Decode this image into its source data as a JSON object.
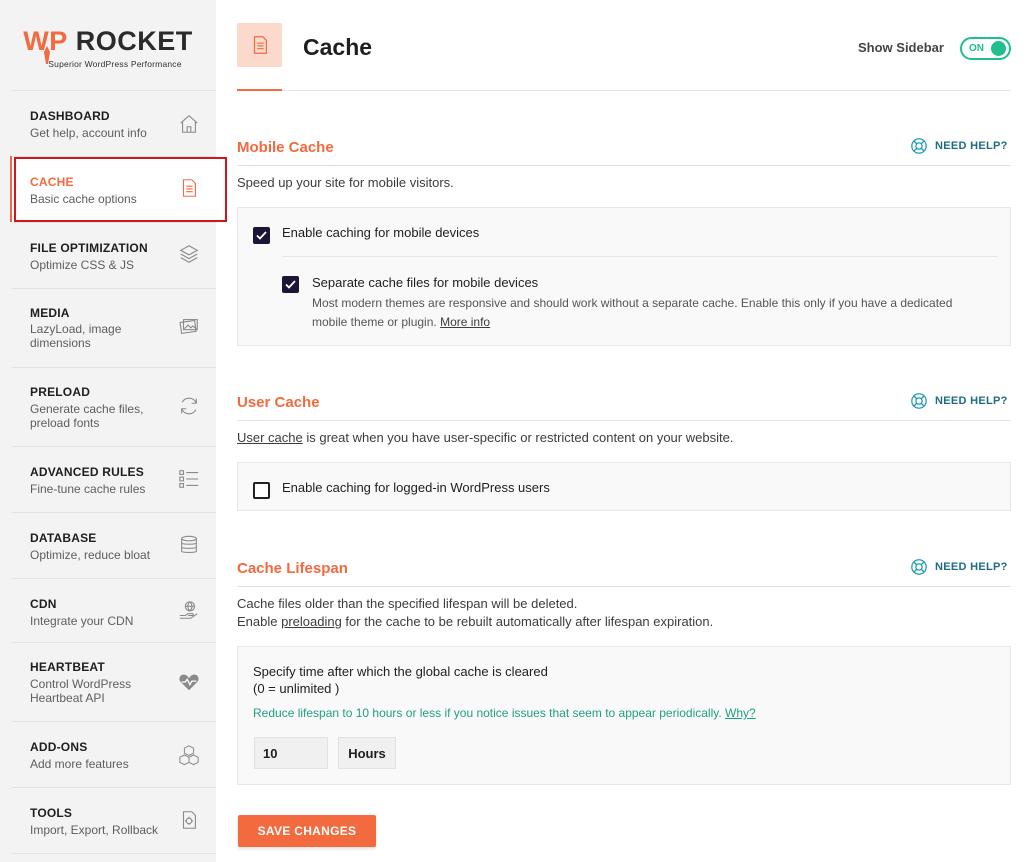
{
  "brand": {
    "name_part1": "WP",
    "name_part2": "ROCKET",
    "tagline": "Superior WordPress Performance",
    "accent": "#f26a3d"
  },
  "sidebar": {
    "items": [
      {
        "title": "DASHBOARD",
        "desc": "Get help, account info",
        "icon": "home-icon"
      },
      {
        "title": "CACHE",
        "desc": "Basic cache options",
        "icon": "document-icon",
        "active": true
      },
      {
        "title": "FILE OPTIMIZATION",
        "desc": "Optimize CSS & JS",
        "icon": "layers-icon"
      },
      {
        "title": "MEDIA",
        "desc": "LazyLoad, image dimensions",
        "icon": "images-icon"
      },
      {
        "title": "PRELOAD",
        "desc": "Generate cache files, preload fonts",
        "icon": "refresh-icon"
      },
      {
        "title": "ADVANCED RULES",
        "desc": "Fine-tune cache rules",
        "icon": "list-icon"
      },
      {
        "title": "DATABASE",
        "desc": "Optimize, reduce bloat",
        "icon": "database-icon"
      },
      {
        "title": "CDN",
        "desc": "Integrate your CDN",
        "icon": "globe-hand-icon"
      },
      {
        "title": "HEARTBEAT",
        "desc": "Control WordPress Heartbeat API",
        "icon": "heartbeat-icon"
      },
      {
        "title": "ADD-ONS",
        "desc": "Add more features",
        "icon": "cubes-icon"
      },
      {
        "title": "TOOLS",
        "desc": "Import, Export, Rollback",
        "icon": "tools-icon"
      }
    ]
  },
  "header": {
    "title": "Cache",
    "show_sidebar_label": "Show Sidebar",
    "toggle_label": "ON"
  },
  "sections": {
    "mobile": {
      "title": "Mobile Cache",
      "help": "NEED HELP?",
      "desc": "Speed up your site for mobile visitors.",
      "opt1": "Enable caching for mobile devices",
      "opt2": "Separate cache files for mobile devices",
      "opt2_desc_line1": "Most modern themes are responsive and should work without a separate cache. Enable this only if you have a dedicated",
      "opt2_desc_line2": "mobile theme or plugin.",
      "opt2_link": "More info"
    },
    "user": {
      "title": "User Cache",
      "help": "NEED HELP?",
      "desc_link": "User cache",
      "desc_rest": " is great when you have user-specific or restricted content on your website.",
      "opt1": "Enable caching for logged-in WordPress users"
    },
    "lifespan": {
      "title": "Cache Lifespan",
      "help": "NEED HELP?",
      "desc_line1": "Cache files older than the specified lifespan will be deleted.",
      "desc_line2_a": "Enable ",
      "desc_line2_link": "preloading",
      "desc_line2_b": " for the cache to be rebuilt automatically after lifespan expiration.",
      "label_line1": "Specify time after which the global cache is cleared",
      "label_line2": "(0 = unlimited )",
      "note": "Reduce lifespan to 10 hours or less if you notice issues that seem to appear periodically. ",
      "note_link": "Why?",
      "value": "10",
      "unit": "Hours"
    }
  },
  "footer": {
    "save_label": "SAVE CHANGES"
  }
}
